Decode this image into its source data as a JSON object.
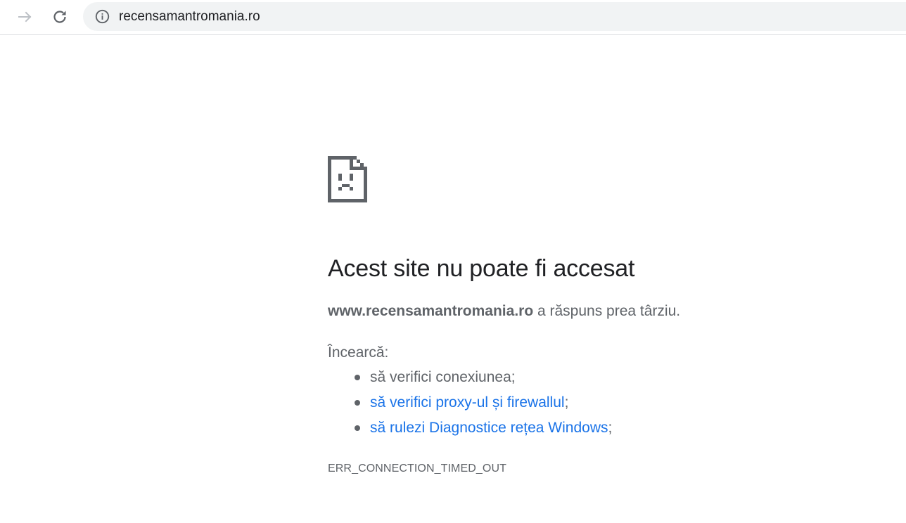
{
  "toolbar": {
    "forward_icon": "arrow-forward-icon",
    "reload_icon": "reload-icon",
    "info_icon": "info-icon",
    "url": "recensamantromania.ro"
  },
  "error": {
    "icon": "sad-document-icon",
    "title": "Acest site nu poate fi accesat",
    "host": "www.recensamantromania.ro",
    "description_suffix": " a răspuns prea târziu.",
    "try_label": "Încearcă:",
    "suggestions": [
      {
        "text": "să verifici conexiunea",
        "suffix": ";",
        "is_link": false
      },
      {
        "text": "să verifici proxy-ul și firewallul",
        "suffix": ";",
        "is_link": true
      },
      {
        "text": "să rulezi Diagnostice rețea Windows",
        "suffix": ";",
        "is_link": true
      }
    ],
    "code": "ERR_CONNECTION_TIMED_OUT"
  },
  "colors": {
    "link": "#1a73e8",
    "text": "#5f6368",
    "title": "#202124",
    "omnibox_bg": "#f1f3f4"
  }
}
